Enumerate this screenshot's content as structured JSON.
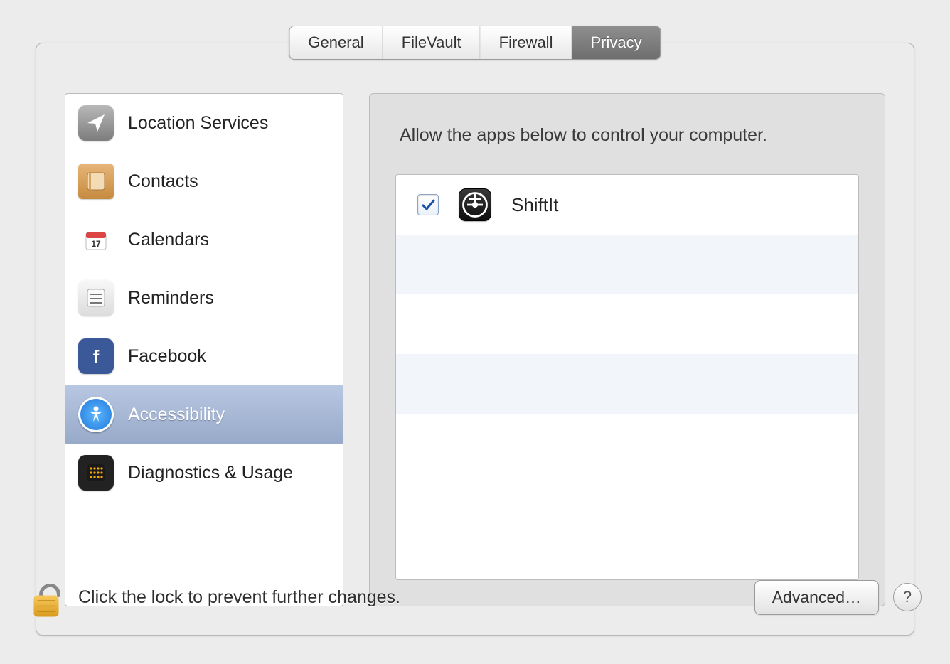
{
  "tabs": [
    {
      "label": "General"
    },
    {
      "label": "FileVault"
    },
    {
      "label": "Firewall"
    },
    {
      "label": "Privacy"
    }
  ],
  "active_tab": "Privacy",
  "sidebar": {
    "items": [
      {
        "label": "Location Services",
        "icon": "location-icon"
      },
      {
        "label": "Contacts",
        "icon": "contacts-icon"
      },
      {
        "label": "Calendars",
        "icon": "calendar-icon"
      },
      {
        "label": "Reminders",
        "icon": "reminders-icon"
      },
      {
        "label": "Facebook",
        "icon": "facebook-icon"
      },
      {
        "label": "Accessibility",
        "icon": "accessibility-icon"
      },
      {
        "label": "Diagnostics & Usage",
        "icon": "diagnostics-icon"
      }
    ],
    "selected": "Accessibility"
  },
  "content": {
    "description": "Allow the apps below to control your computer.",
    "apps": [
      {
        "name": "ShiftIt",
        "checked": true
      }
    ]
  },
  "footer": {
    "lock_message": "Click the lock to prevent further changes.",
    "advanced_label": "Advanced…",
    "help_label": "?"
  },
  "calendar_icon_day": "17"
}
